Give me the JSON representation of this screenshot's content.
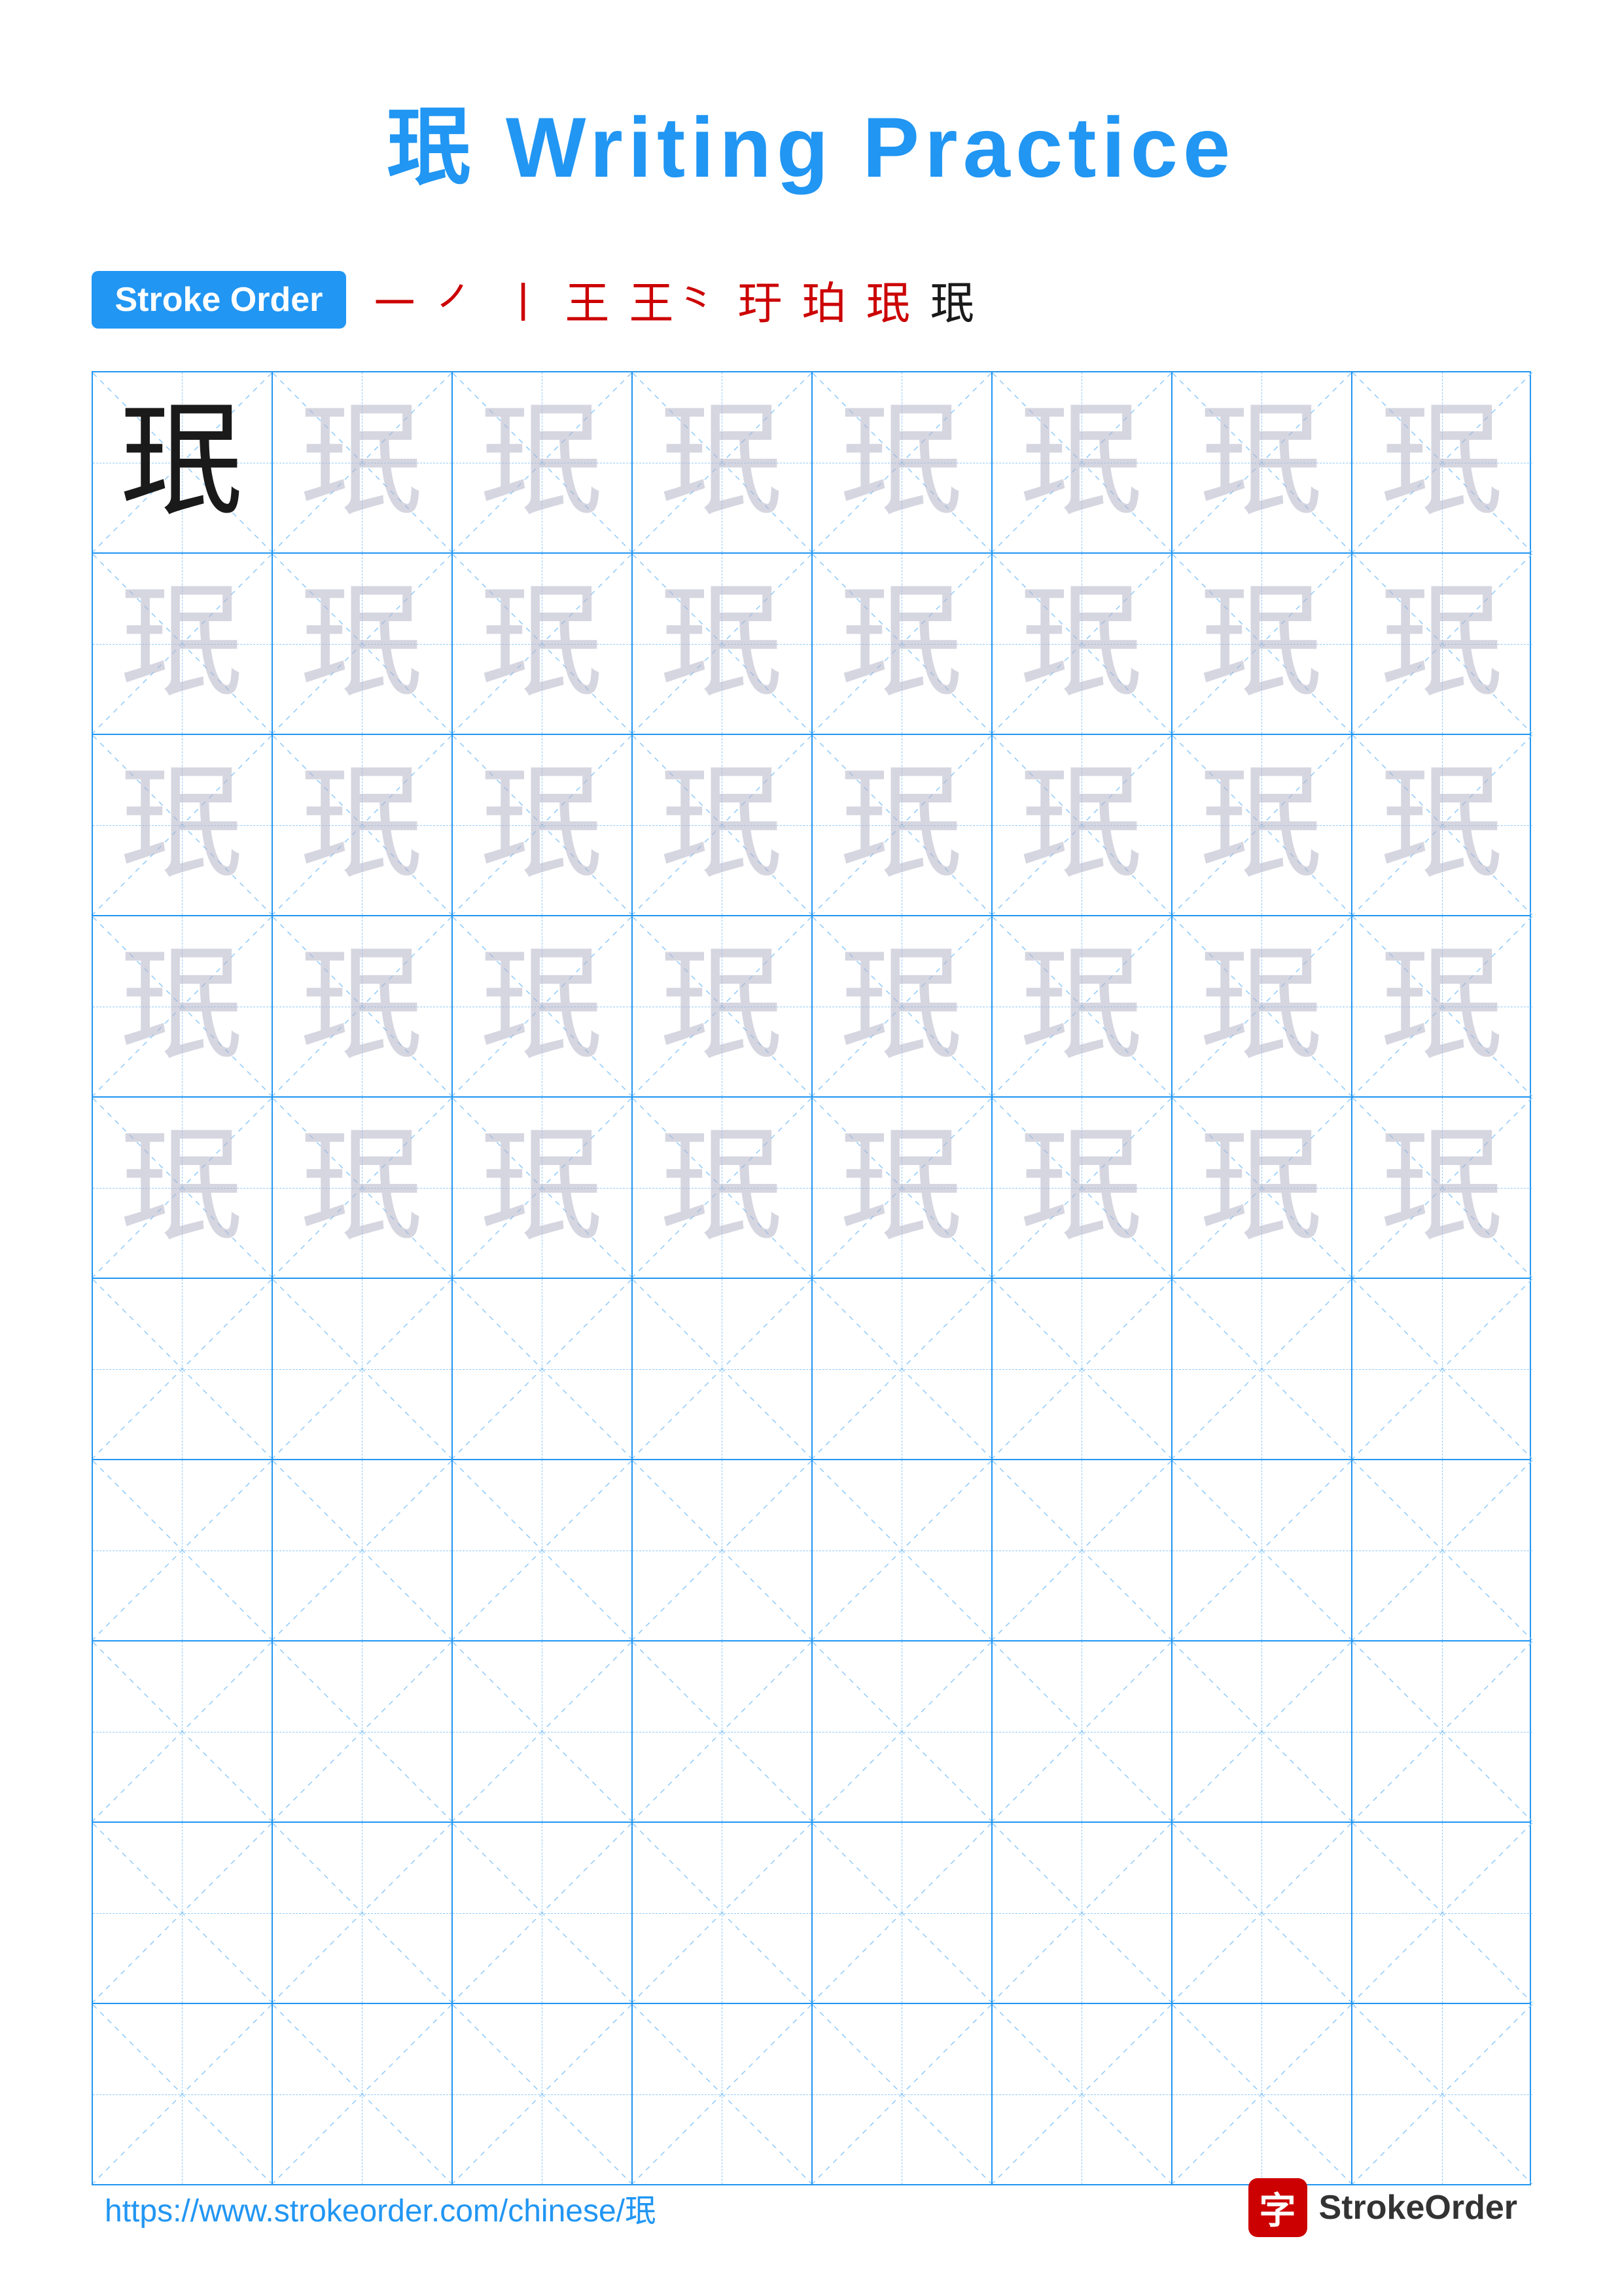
{
  "title": "珉 Writing Practice",
  "stroke_order_badge": "Stroke Order",
  "stroke_steps": [
    "㇐",
    "㇒",
    "㇑",
    "王",
    "王⺀",
    "玉⺀",
    "珉⺀",
    "珉㇀",
    "珉"
  ],
  "character": "珉",
  "grid": {
    "rows": 10,
    "cols": 8,
    "guide_rows": 5,
    "practice_rows": 5
  },
  "footer": {
    "url": "https://www.strokeorder.com/chinese/珉",
    "logo_char": "字",
    "logo_name": "StrokeOrder"
  }
}
